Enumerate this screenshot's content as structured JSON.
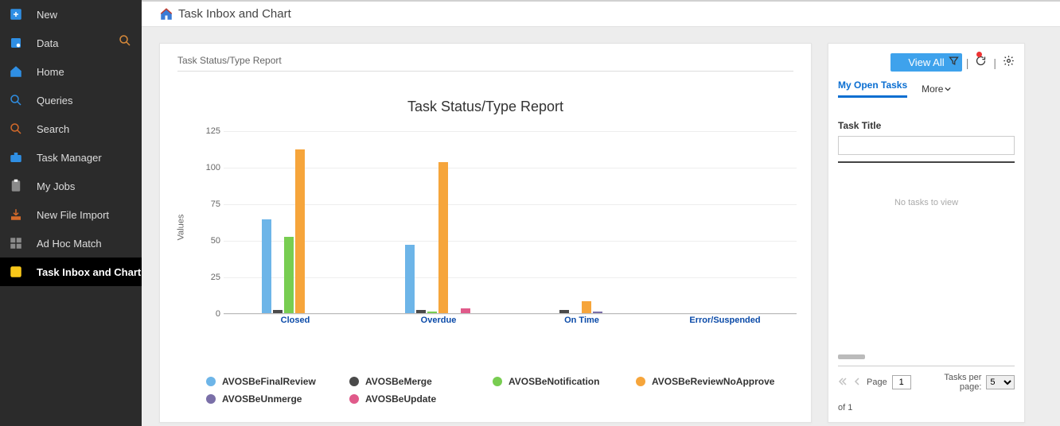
{
  "sidebar": {
    "items": [
      {
        "label": "New",
        "icon": "plus-square-icon",
        "color": "#2f8fe4"
      },
      {
        "label": "Data",
        "icon": "database-icon",
        "color": "#2f8fe4"
      },
      {
        "label": "Home",
        "icon": "home-sidebar-icon",
        "color": "#2f8fe4"
      },
      {
        "label": "Queries",
        "icon": "search-small-icon",
        "color": "#2f8fe4"
      },
      {
        "label": "Search",
        "icon": "search-red-icon",
        "color": "#d46a2a"
      },
      {
        "label": "Task Manager",
        "icon": "briefcase-icon",
        "color": "#2f8fe4"
      },
      {
        "label": "My Jobs",
        "icon": "clipboard-icon",
        "color": "#8a8a8a"
      },
      {
        "label": "New File Import",
        "icon": "import-icon",
        "color": "#d46a2a"
      },
      {
        "label": "Ad Hoc Match",
        "icon": "grid-icon",
        "color": "#8a8a8a"
      },
      {
        "label": "Task Inbox and Chart",
        "icon": "task-inbox-icon",
        "color": "#f9c81a",
        "active": true
      }
    ]
  },
  "header": {
    "title": "Task Inbox and Chart"
  },
  "chart": {
    "subtitle": "Task Status/Type Report"
  },
  "panel": {
    "view_all": "View All",
    "tab_open": "My Open Tasks",
    "more": "More",
    "task_title_label": "Task Title",
    "no_tasks": "No tasks to view",
    "page_label": "Page",
    "page_value": "1",
    "of_label": "of 1",
    "tpp_label": "Tasks per page:",
    "tpp_value": "5"
  },
  "chart_data": {
    "type": "bar",
    "title": "Task Status/Type Report",
    "xlabel": "",
    "ylabel": "Values",
    "ylim": [
      0,
      125
    ],
    "yticks": [
      0,
      25,
      50,
      75,
      100,
      125
    ],
    "categories": [
      "Closed",
      "Overdue",
      "On Time",
      "Error/Suspended"
    ],
    "series": [
      {
        "name": "AVOSBeFinalReview",
        "color": "#6db5e8",
        "values": [
          64,
          47,
          0,
          0
        ]
      },
      {
        "name": "AVOSBeMerge",
        "color": "#4a4a4a",
        "values": [
          2,
          2,
          2,
          0
        ]
      },
      {
        "name": "AVOSBeNotification",
        "color": "#78cd51",
        "values": [
          52,
          1,
          0,
          0
        ]
      },
      {
        "name": "AVOSBeReviewNoApprove",
        "color": "#f6a53b",
        "values": [
          112,
          103,
          8,
          0
        ]
      },
      {
        "name": "AVOSBeUnmerge",
        "color": "#7a6fa8",
        "values": [
          0,
          0,
          1,
          0
        ]
      },
      {
        "name": "AVOSBeUpdate",
        "color": "#e05a8a",
        "values": [
          0,
          3,
          0,
          0
        ]
      }
    ]
  }
}
